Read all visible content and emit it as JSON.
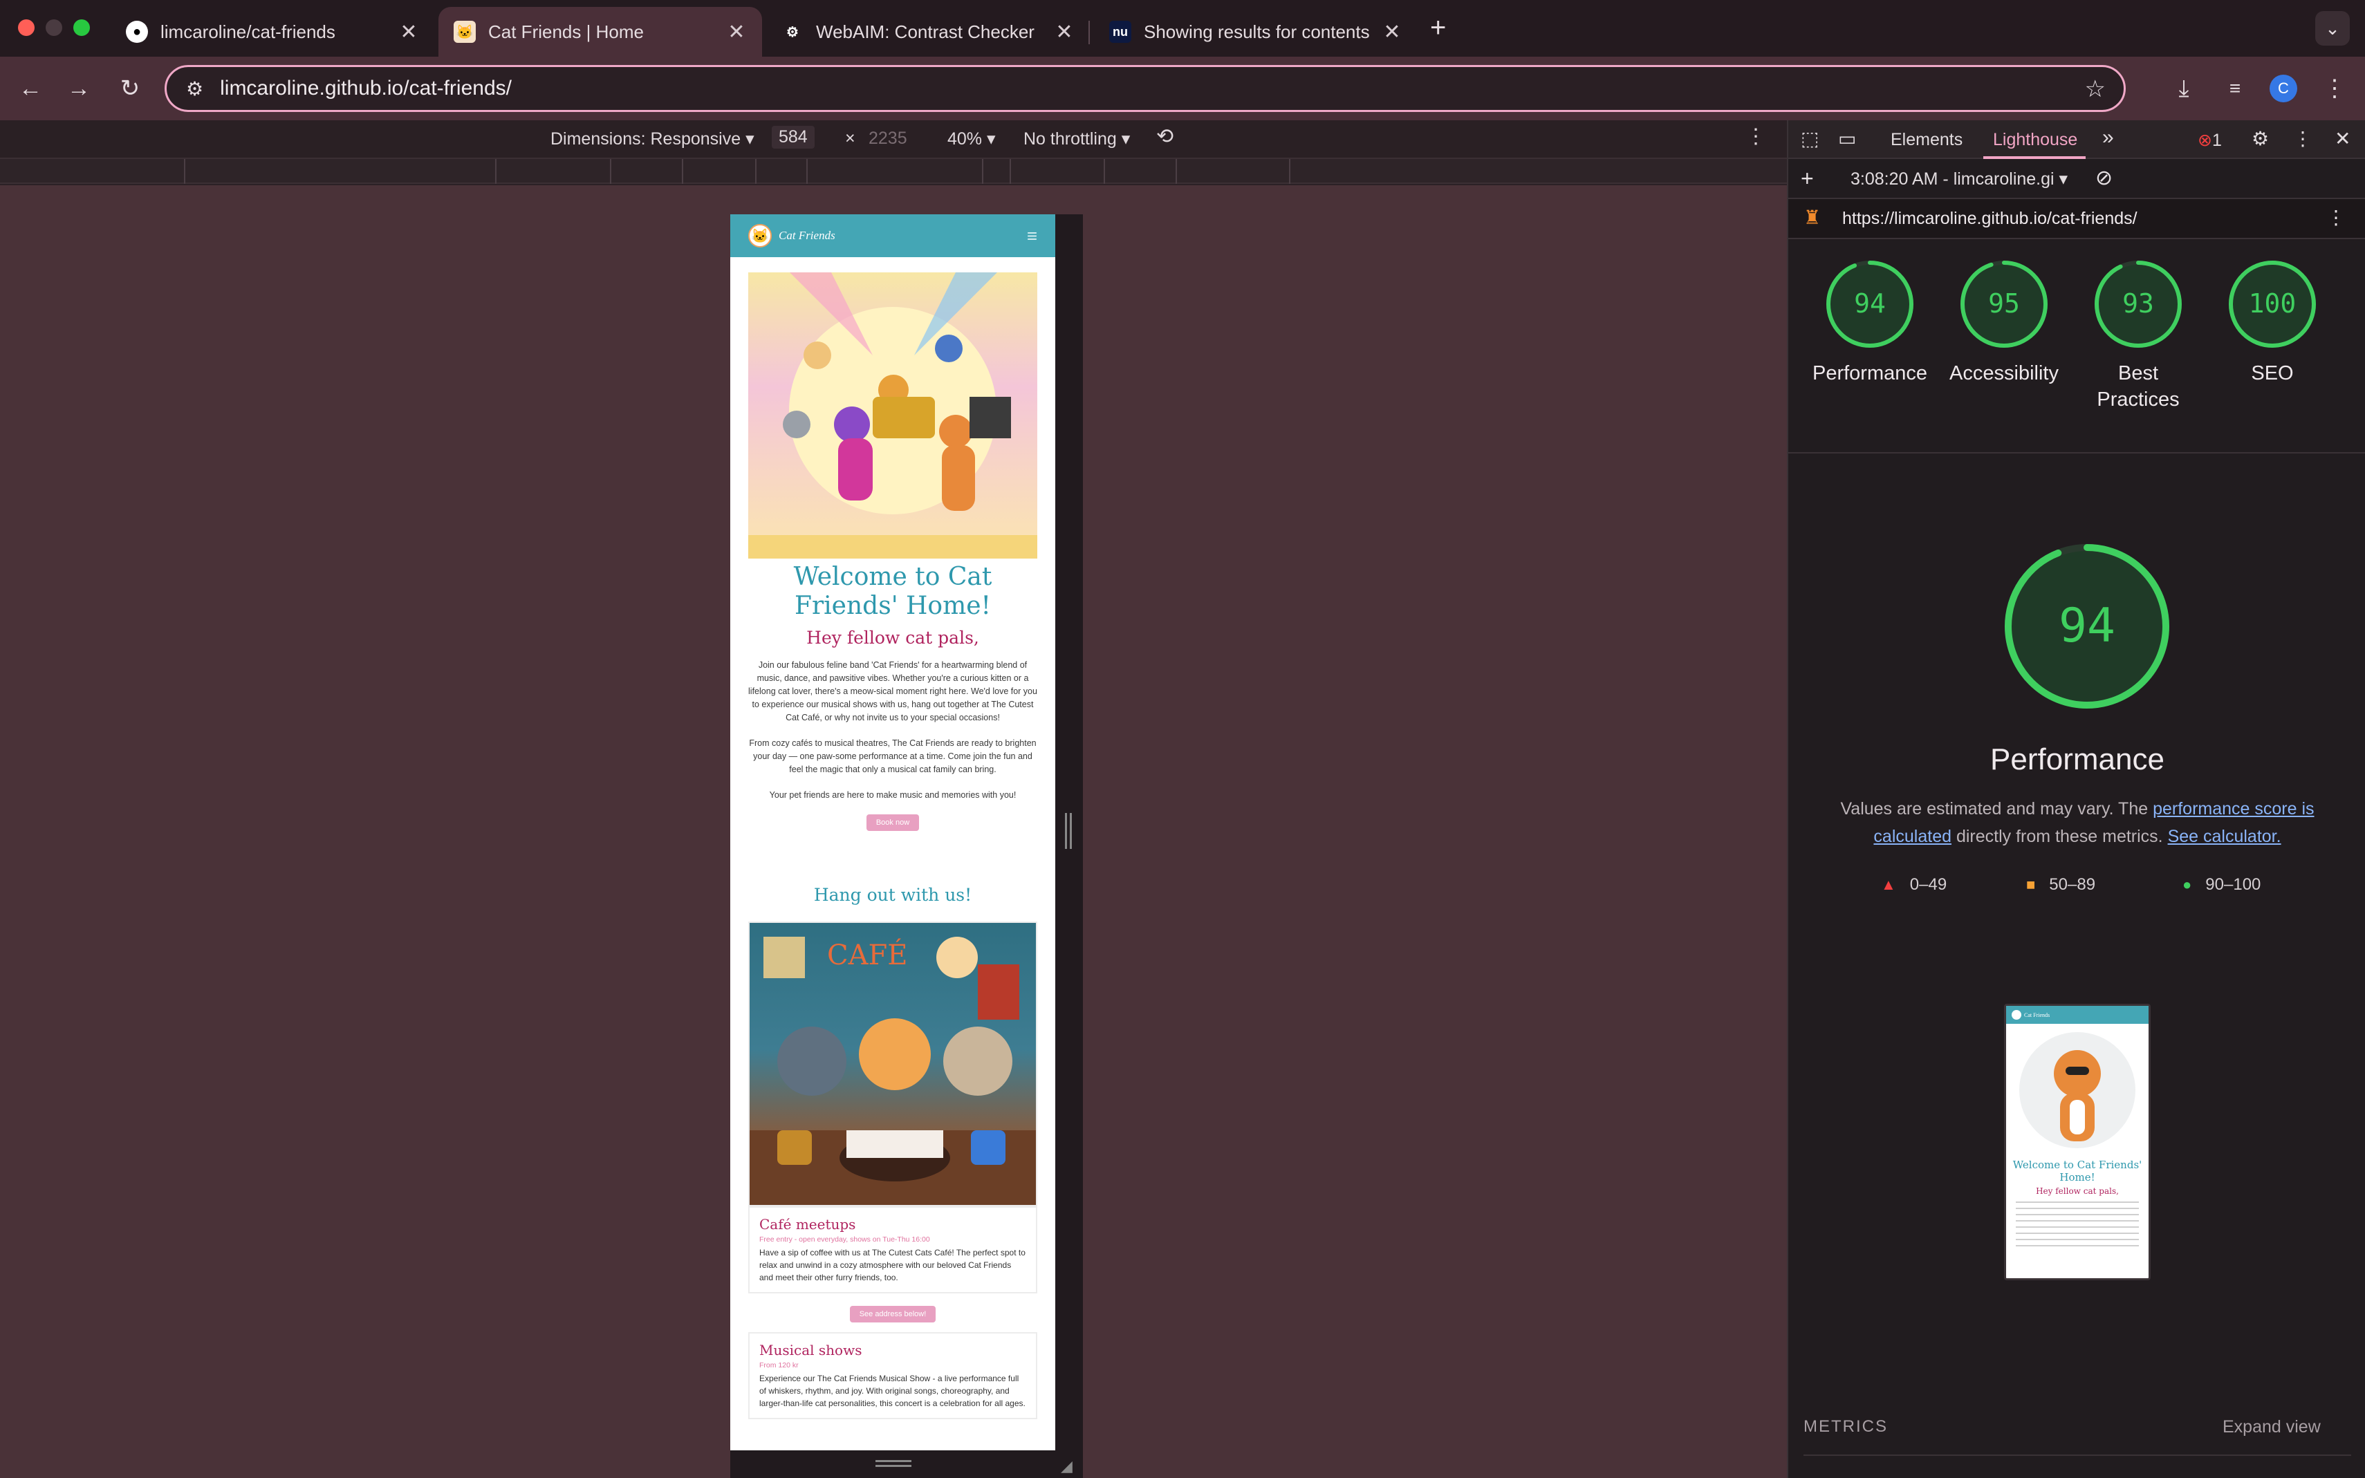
{
  "browser": {
    "tabs": [
      {
        "title": "limcaroline/cat-friends",
        "icon": "github-icon",
        "active": false
      },
      {
        "title": "Cat Friends | Home",
        "icon": "cat-favicon",
        "active": true
      },
      {
        "title": "WebAIM: Contrast Checker",
        "icon": "webaim-gear-icon",
        "active": false
      },
      {
        "title": "Showing results for contents",
        "icon": "nu-icon",
        "active": false
      }
    ],
    "nu_icon_text": "nu",
    "new_tab": "+",
    "close": "✕",
    "address": {
      "host": "limcaroline.github.io",
      "path": "/cat-friends/"
    },
    "profile_initial": "C"
  },
  "device_toolbar": {
    "dimensions": "Dimensions: Responsive",
    "width": "584",
    "times": "×",
    "height": "2235",
    "zoom": "40%",
    "throttling": "No throttling"
  },
  "site": {
    "brand": "Cat Friends",
    "heading": "Welcome to Cat Friends' Home!",
    "subheading": "Hey fellow cat pals,",
    "para1": "Join our fabulous feline band 'Cat Friends' for a heartwarming blend of music, dance, and pawsitive vibes. Whether you're a curious kitten or a lifelong cat lover, there's a meow-sical moment right here. We'd love for you to experience our musical shows with us, hang out together at The Cutest Cat Café, or why not invite us to your special occasions!",
    "para2": "From cozy cafés to musical theatres, The Cat Friends are ready to brighten your day — one paw-some performance at a time. Come join the fun and feel the magic that only a musical cat family can bring.",
    "para3": "Your pet friends are here to make music and memories with you!",
    "book_button": "Book now",
    "hangout": "Hang out with us!",
    "cafe_sign": "CAFÉ",
    "card1": {
      "title": "Café meetups",
      "meta": "Free entry - open everyday, shows on Tue-Thu 16:00",
      "text": "Have a sip of coffee with us at The Cutest Cats Café! The perfect spot to relax and unwind in a cozy atmosphere with our beloved Cat Friends and meet their other furry friends, too."
    },
    "address_button": "See address below!",
    "card2": {
      "title": "Musical shows",
      "meta": "From 120 kr",
      "text": "Experience our The Cat Friends Musical Show - a live performance full of whiskers, rhythm, and joy. With original songs, choreography, and larger-than-life cat personalities, this concert is a celebration for all ages."
    }
  },
  "devtools": {
    "tabs": {
      "elements": "Elements",
      "lighthouse": "Lighthouse",
      "more": "»"
    },
    "error_count": "1",
    "report_time": "3:08:20 AM - limcaroline.gi",
    "report_url": "https://limcaroline.github.io/cat-friends/",
    "scores": [
      {
        "label": "Performance",
        "value": 94
      },
      {
        "label": "Accessibility",
        "value": 95
      },
      {
        "label": "Best Practices",
        "value": 93
      },
      {
        "label": "SEO",
        "value": 100
      }
    ],
    "main_score": 94,
    "main_label": "Performance",
    "desc_pre": "Values are estimated and may vary. The ",
    "desc_link1": "performance score is calculated",
    "desc_mid": " directly from these metrics. ",
    "desc_link2": "See calculator.",
    "legend": [
      {
        "range": "0–49",
        "shape": "triangle",
        "color": "#f33f3f"
      },
      {
        "range": "50–89",
        "shape": "square",
        "color": "#f7a235"
      },
      {
        "range": "90–100",
        "shape": "circle",
        "color": "#3fcf5f"
      }
    ],
    "thumb": {
      "brand": "Cat Friends",
      "heading": "Welcome to Cat Friends' Home!",
      "sub": "Hey fellow cat pals,"
    },
    "metrics_label": "METRICS",
    "expand": "Expand view",
    "score_color": "#3fcf5f"
  }
}
